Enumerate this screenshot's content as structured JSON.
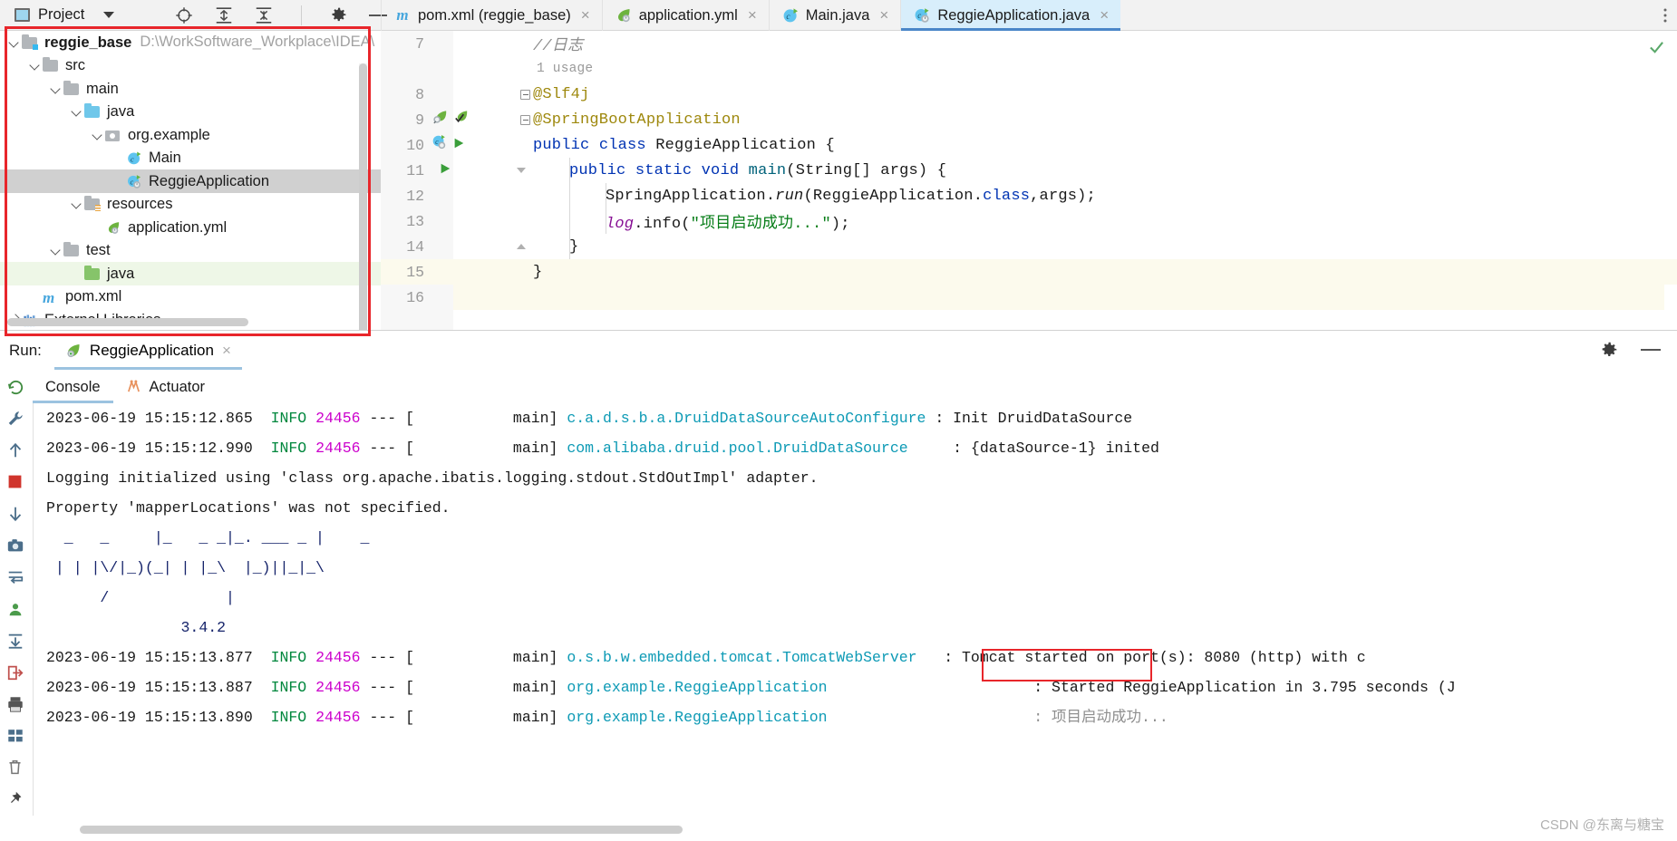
{
  "topbar": {
    "project_button": "Project",
    "icons": [
      "locate-icon",
      "expand-all-icon",
      "collapse-all-icon",
      "gear-icon",
      "minimize-icon"
    ]
  },
  "editor_tabs": [
    {
      "label": "pom.xml (reggie_base)",
      "icon": "maven-icon",
      "active": false,
      "close": "×"
    },
    {
      "label": "application.yml",
      "icon": "spring-yaml-icon",
      "active": false,
      "close": "×"
    },
    {
      "label": "Main.java",
      "icon": "java-class-icon",
      "active": false,
      "close": "×"
    },
    {
      "label": "ReggieApplication.java",
      "icon": "spring-boot-class-icon",
      "active": true,
      "close": "×"
    }
  ],
  "project_tree": [
    {
      "label": "reggie_base",
      "path": "D:\\WorkSoftware_Workplace\\IDEA\\",
      "icon": "module-folder-icon",
      "indent": 0,
      "arrow": "open",
      "bold": true,
      "state": "normal"
    },
    {
      "label": "src",
      "path": "",
      "icon": "folder-gray-icon",
      "indent": 1,
      "arrow": "open",
      "bold": false,
      "state": "normal"
    },
    {
      "label": "main",
      "path": "",
      "icon": "folder-gray-icon",
      "indent": 2,
      "arrow": "open",
      "bold": false,
      "state": "normal"
    },
    {
      "label": "java",
      "path": "",
      "icon": "folder-blue-source-icon",
      "indent": 3,
      "arrow": "open",
      "bold": false,
      "state": "normal"
    },
    {
      "label": "org.example",
      "path": "",
      "icon": "package-icon",
      "indent": 4,
      "arrow": "open",
      "bold": false,
      "state": "normal"
    },
    {
      "label": "Main",
      "path": "",
      "icon": "java-class-icon",
      "indent": 5,
      "arrow": "none",
      "bold": false,
      "state": "normal"
    },
    {
      "label": "ReggieApplication",
      "path": "",
      "icon": "spring-boot-class-icon",
      "indent": 5,
      "arrow": "none",
      "bold": false,
      "state": "selected"
    },
    {
      "label": "resources",
      "path": "",
      "icon": "folder-resources-icon",
      "indent": 3,
      "arrow": "open",
      "bold": false,
      "state": "normal"
    },
    {
      "label": "application.yml",
      "path": "",
      "icon": "spring-yaml-icon",
      "indent": 4,
      "arrow": "none",
      "bold": false,
      "state": "normal"
    },
    {
      "label": "test",
      "path": "",
      "icon": "folder-gray-icon",
      "indent": 2,
      "arrow": "open",
      "bold": false,
      "state": "normal"
    },
    {
      "label": "java",
      "path": "",
      "icon": "folder-green-test-icon",
      "indent": 3,
      "arrow": "none",
      "bold": false,
      "state": "green"
    },
    {
      "label": "pom.xml",
      "path": "",
      "icon": "maven-icon",
      "indent": 1,
      "arrow": "none",
      "bold": false,
      "state": "normal"
    },
    {
      "label": "External Libraries",
      "path": "",
      "icon": "libraries-icon",
      "indent": 0,
      "arrow": "closed",
      "bold": false,
      "state": "normal"
    }
  ],
  "editor": {
    "inlay_usage": "1 usage",
    "lines": [
      {
        "num": "7",
        "text": "//日志"
      },
      {
        "num": "8",
        "text": "@Slf4j"
      },
      {
        "num": "9",
        "text": "@SpringBootApplication"
      },
      {
        "num": "10",
        "text": "public class ReggieApplication {"
      },
      {
        "num": "11",
        "text": "    public static void main(String[] args) {"
      },
      {
        "num": "12",
        "text": "        SpringApplication.run(ReggieApplication.class,args);"
      },
      {
        "num": "13",
        "text": "        log.info(\"项目启动成功...\");"
      },
      {
        "num": "14",
        "text": "    }"
      },
      {
        "num": "15",
        "text": "}"
      },
      {
        "num": "16",
        "text": ""
      }
    ],
    "tokens": {
      "comment": "//日志",
      "ann_slf4j": "@Slf4j",
      "ann_springboot": "@SpringBootApplication",
      "kw_public": "public",
      "kw_class": "class",
      "kw_static": "static",
      "kw_void": "void",
      "cls_name": "ReggieApplication",
      "mth_main": "main",
      "arg_string": "String[] args",
      "spring_app": "SpringApplication",
      "mth_run": "run",
      "kw_class_lit": "class",
      "args_call": "args",
      "fld_log": "log",
      "mth_info": "info",
      "str_chinese": "\"项目启动成功...\"",
      "brace_open": "{",
      "brace_close": "}",
      "paren_open": "(",
      "paren_close": ")",
      "semi": ";"
    }
  },
  "run_panel": {
    "run_label": "Run:",
    "config_tab": "ReggieApplication",
    "config_close": "×",
    "subtabs": [
      {
        "label": "Console",
        "icon": "console-icon",
        "active": true
      },
      {
        "label": "Actuator",
        "icon": "actuator-icon",
        "active": false
      }
    ],
    "toolbar_icons": [
      "rerun-icon",
      "wrench-icon",
      "scroll-up-icon",
      "stop-icon",
      "scroll-down-icon",
      "camera-icon",
      "soft-wrap-icon",
      "thread-dump-icon",
      "scroll-to-end-icon",
      "export-icon",
      "print-icon",
      "grid-icon",
      "trash-icon",
      "pin-icon"
    ],
    "gear_icon": "settings-icon",
    "minimize_icon": "minimize-icon"
  },
  "console_lines": [
    {
      "type": "log",
      "ts": "2023-06-19 15:15:12.865",
      "level": "INFO",
      "pid": "24456",
      "sep": "--- [",
      "thread": "           main]",
      "logger": "c.a.d.s.b.a.DruidDataSourceAutoConfigure",
      "msg": ": Init DruidDataSource",
      "pad_logger": 41
    },
    {
      "type": "log",
      "ts": "2023-06-19 15:15:12.990",
      "level": "INFO",
      "pid": "24456",
      "sep": "--- [",
      "thread": "           main]",
      "logger": "com.alibaba.druid.pool.DruidDataSource",
      "msg": "  : {dataSource-1} inited",
      "pad_logger": 41
    },
    {
      "type": "plain",
      "text": "Logging initialized using 'class org.apache.ibatis.logging.stdout.StdOutImpl' adapter."
    },
    {
      "type": "plain",
      "text": "Property 'mapperLocations' was not specified."
    },
    {
      "type": "banner",
      "text": "  _   _     |_   _ _|_. ___ _ |    _"
    },
    {
      "type": "banner",
      "text": " | | |\\/|_)(_| | |_\\  |_)||_|_\\"
    },
    {
      "type": "banner",
      "text": "      /             |"
    },
    {
      "type": "banner",
      "text": "               3.4.2"
    },
    {
      "type": "log",
      "ts": "2023-06-19 15:15:13.877",
      "level": "INFO",
      "pid": "24456",
      "sep": "--- [",
      "thread": "           main]",
      "logger": "o.s.b.w.embedded.tomcat.TomcatWebServer",
      "msg": " : Tomcat started on port(s): 8080 (http) with c",
      "pad_logger": 41
    },
    {
      "type": "log",
      "ts": "2023-06-19 15:15:13.887",
      "level": "INFO",
      "pid": "24456",
      "sep": "--- [",
      "thread": "           main]",
      "logger": "org.example.ReggieApplication",
      "msg": "           : Started ReggieApplication in 3.795 seconds (J",
      "pad_logger": 41
    },
    {
      "type": "log",
      "ts": "2023-06-19 15:15:13.890",
      "level": "INFO",
      "pid": "24456",
      "sep": "--- [",
      "thread": "           main]",
      "logger": "org.example.ReggieApplication",
      "msg": "           : 项目启动成功...",
      "pad_logger": 41,
      "highlight": true
    }
  ],
  "watermark": "CSDN @东离与糖宝",
  "colors": {
    "accent_red_box": "#e8262b",
    "tab_active_bg": "#d8eefb",
    "tab_active_underline": "#4a86c8",
    "tree_selected_bg": "#d0d0d0",
    "tree_green_bg": "#eef7e7",
    "log_info_green": "#00873d",
    "log_pid_magenta": "#cc00cc",
    "log_logger_teal": "#0d9ab5",
    "banner_navy": "#16246b"
  }
}
